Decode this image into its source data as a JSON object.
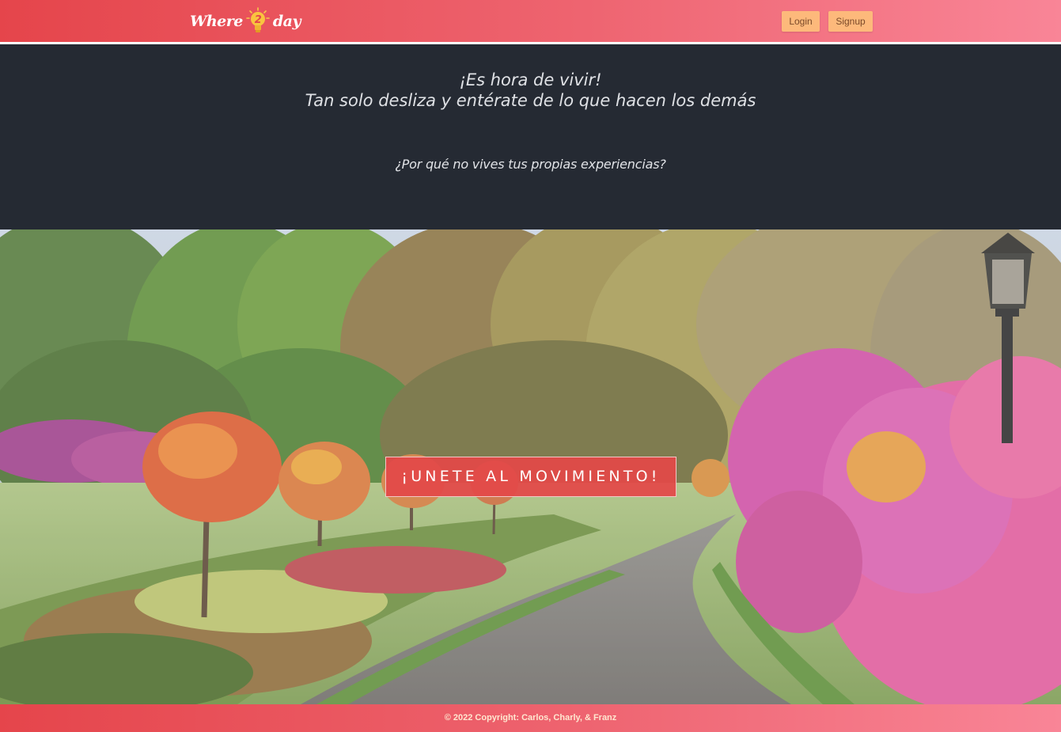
{
  "brand": {
    "name_left": "Where",
    "name_digit": "2",
    "name_right": "day"
  },
  "nav": {
    "login_label": "Login",
    "signup_label": "Signup"
  },
  "intro": {
    "line1": "¡Es hora de vivir!",
    "line2": "Tan solo desliza y entérate de lo que hacen los demás",
    "question": "¿Por qué no vives tus propias experiencias?"
  },
  "hero": {
    "cta_label": "¡UNETE AL MOVIMIENTO!"
  },
  "footer": {
    "copyright": "© 2022 Copyright: Carlos, Charly, & Franz"
  },
  "colors": {
    "gradient_start": "#e5454b",
    "gradient_end": "#f98597",
    "intro_bg": "#252a33",
    "button_bg": "#fdb97b",
    "cta_bg": "#e34848"
  }
}
